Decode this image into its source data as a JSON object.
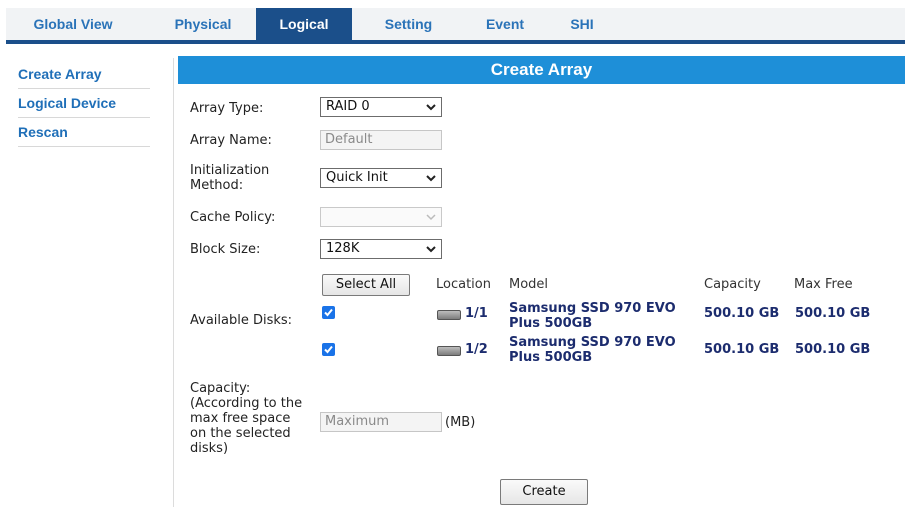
{
  "tabs": [
    "Global View",
    "Physical",
    "Logical",
    "Setting",
    "Event",
    "SHI"
  ],
  "active_tab": "Logical",
  "sidebar": {
    "items": [
      "Create Array",
      "Logical Device",
      "Rescan"
    ]
  },
  "panel": {
    "title": "Create Array"
  },
  "form": {
    "array_type": {
      "label": "Array Type:",
      "value": "RAID 0"
    },
    "array_name": {
      "label": "Array Name:",
      "placeholder": "Default"
    },
    "init_method": {
      "label_line1": "Initialization",
      "label_line2": "Method:",
      "value": "Quick Init"
    },
    "cache_policy": {
      "label": "Cache Policy:",
      "value": ""
    },
    "block_size": {
      "label": "Block Size:",
      "value": "128K"
    },
    "available_disks_label": "Available Disks:",
    "select_all": "Select All",
    "columns": {
      "location": "Location",
      "model": "Model",
      "capacity": "Capacity",
      "max_free": "Max Free"
    },
    "disks": [
      {
        "checked": true,
        "location": "1/1",
        "model": "Samsung SSD 970 EVO Plus 500GB",
        "capacity": "500.10 GB",
        "max_free": "500.10 GB"
      },
      {
        "checked": true,
        "location": "1/2",
        "model": "Samsung SSD 970 EVO Plus 500GB",
        "capacity": "500.10 GB",
        "max_free": "500.10 GB"
      }
    ],
    "capacity": {
      "label_lines": [
        "Capacity:",
        "(According to the",
        "max free space",
        "on the selected",
        "disks)"
      ],
      "placeholder": "Maximum",
      "unit": "(MB)"
    },
    "create_button": "Create"
  },
  "colors": {
    "tab_active_bg": "#1b4f8a",
    "panel_title_bg": "#1e8fd8",
    "link_blue": "#1f6fb8",
    "disk_text": "#1c2c6e",
    "checkbox": "#1a73e8"
  }
}
